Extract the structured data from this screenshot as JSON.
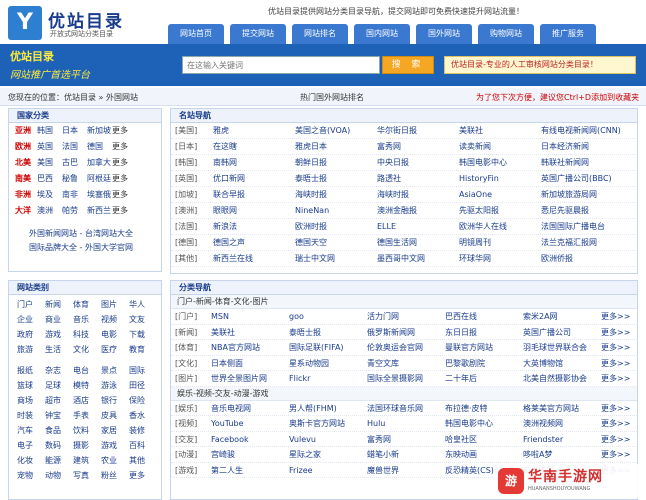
{
  "logo": {
    "mark": "Y",
    "name": "优站目录",
    "tagline": "开放式网站分类目录"
  },
  "slogan": "优站目录提供网站分类目录导航，提交网站即可免费快速提升网站流量！",
  "nav": [
    "网站首页",
    "提交网站",
    "网站排名",
    "国内网站",
    "国外网站",
    "购物网站",
    "推广服务"
  ],
  "brand": {
    "line1": "优站目录",
    "line2": "网站推广首选平台"
  },
  "search": {
    "placeholder": "在这输入关键词",
    "button": "搜 索"
  },
  "promo": "优站目录-专业的人工审核网站分类目录！",
  "crumb": {
    "path": "您现在的位置：优站目录 » 外国网站",
    "middle": "热门国外网站排名",
    "right": "为了您下次方便，建议您Ctrl+D添加到收藏夹"
  },
  "countries": {
    "title": "国家分类",
    "more": "更多",
    "rows": [
      {
        "region": "亚洲",
        "items": [
          "韩国",
          "日本",
          "新加坡"
        ]
      },
      {
        "region": "欧洲",
        "items": [
          "英国",
          "法国",
          "德国"
        ]
      },
      {
        "region": "北美",
        "items": [
          "美国",
          "古巴",
          "加拿大"
        ]
      },
      {
        "region": "南美",
        "items": [
          "巴西",
          "秘鲁",
          "阿根廷"
        ]
      },
      {
        "region": "非洲",
        "items": [
          "埃及",
          "南非",
          "埃塞俄"
        ]
      },
      {
        "region": "大洋",
        "items": [
          "澳洲",
          "帕劳",
          "新西兰"
        ]
      }
    ],
    "extra": [
      "外国新闻网站 - 台湾网站大全",
      "国际品牌大全 - 外国大学官网"
    ]
  },
  "categories": {
    "title": "网站类别",
    "block1": [
      "门户",
      "新闻",
      "体育",
      "图片",
      "华人",
      "企业",
      "商业",
      "音乐",
      "视频",
      "文友",
      "政府",
      "游戏",
      "科技",
      "电影",
      "下载",
      "旅游",
      "生活",
      "文化",
      "医疗",
      "教育"
    ],
    "block2": [
      "报纸",
      "杂志",
      "电台",
      "景点",
      "国际",
      "篮球",
      "足球",
      "模特",
      "游泳",
      "田径",
      "商场",
      "超市",
      "酒店",
      "银行",
      "保险",
      "时装",
      "钟宝",
      "手表",
      "皮具",
      "香水",
      "汽车",
      "食品",
      "饮料",
      "家居",
      "装修",
      "电子",
      "数码",
      "摄影",
      "游戏",
      "百科",
      "化妆",
      "能源",
      "建筑",
      "农业",
      "其他",
      "宠物",
      "动物",
      "写真",
      "粉丝",
      "更多"
    ]
  },
  "famous": {
    "title": "名站导航",
    "rows": [
      {
        "k": "[美国]",
        "v": [
          "雅虎",
          "美国之音(VOA)",
          "华尔街日报",
          "美联社",
          "有线电视新闻网(CNN)"
        ]
      },
      {
        "k": "[日本]",
        "v": [
          "在这瞎",
          "雅虎日本",
          "富秀网",
          "读卖新闻",
          "日本经济新闻"
        ]
      },
      {
        "k": "[韩国]",
        "v": [
          "南韩网",
          "朝鲜日报",
          "中央日报",
          "韩国电影中心",
          "韩联社新闻网"
        ]
      },
      {
        "k": "[英国]",
        "v": [
          "优口新网",
          "泰晤士报",
          "路透社",
          "HistoryFin",
          "英国广播公司(BBC)"
        ]
      },
      {
        "k": "[加坡]",
        "v": [
          "联合早报",
          "海峡时报",
          "海峡时报",
          "AsiaOne",
          "新加坡旅游局网"
        ]
      },
      {
        "k": "[澳洲]",
        "v": [
          "眼眼网",
          "NineNan",
          "澳洲金融报",
          "先驱太阳报",
          "悉尼先驱晨报"
        ]
      },
      {
        "k": "[法国]",
        "v": [
          "新浪法",
          "欧洲时报",
          "ELLE",
          "欧洲华人在线",
          "法国国际广播电台"
        ]
      },
      {
        "k": "[德国]",
        "v": [
          "德国之声",
          "德国天空",
          "德国生活网",
          "明镜周刊",
          "法兰克福汇报网"
        ]
      },
      {
        "k": "[其他]",
        "v": [
          "新西兰在线",
          "瑞士中文网",
          "墨西哥中文网",
          "环球华网",
          "欧洲侨报"
        ]
      }
    ]
  },
  "classified": {
    "title": "分类导航",
    "more": "更多>>",
    "sections": [
      {
        "name": "门户-新闻-体育-文化-图片",
        "rows": [
          {
            "k": "[门户]",
            "v": [
              "MSN",
              "goo",
              "活力门网",
              "巴西在线",
              "索米2A网"
            ]
          },
          {
            "k": "[新闻]",
            "v": [
              "美联社",
              "泰晤士报",
              "俄罗斯新闻网",
              "东日日报",
              "英国广播公司"
            ]
          },
          {
            "k": "[体育]",
            "v": [
              "NBA官方网站",
              "国际足联(FIFA)",
              "伦敦奥运会官网",
              "曼联官方网站",
              "羽毛球世界联合会"
            ]
          },
          {
            "k": "[文化]",
            "v": [
              "日本侧面",
              "星系动物园",
              "青空文库",
              "巴黎歌剧院",
              "大英博物馆"
            ]
          },
          {
            "k": "[图片]",
            "v": [
              "世界全景图片网",
              "Flickr",
              "国际全景摄影网",
              "二十年后",
              "北美自然摄影协会"
            ]
          }
        ]
      },
      {
        "name": "娱乐-视频-交友-动漫-游戏",
        "rows": [
          {
            "k": "[娱乐]",
            "v": [
              "音乐电视网",
              "男人帮(FHM)",
              "法国环球音乐网",
              "布拉德·皮特",
              "格莱美官方网站"
            ]
          },
          {
            "k": "[视频]",
            "v": [
              "YouTube",
              "奥斯卡官方网站",
              "Hulu",
              "韩国电影中心",
              "澳洲视频网"
            ]
          },
          {
            "k": "[交友]",
            "v": [
              "Facebook",
              "Vulevu",
              "富秀网",
              "哈皇社区",
              "Friendster"
            ]
          },
          {
            "k": "[动漫]",
            "v": [
              "宫崎骏",
              "星际之家",
              "蜡笔小新",
              "东映动画",
              "哆啦A梦"
            ]
          },
          {
            "k": "[游戏]",
            "v": [
              "第二人生",
              "Frizee",
              "魔兽世界",
              "反恐精英(CS)",
              "EVE中国"
            ]
          }
        ]
      }
    ]
  },
  "watermark": {
    "logo": "华南手游网",
    "sub": "HUANANSHOUYOUWANG",
    "icon": "游"
  }
}
